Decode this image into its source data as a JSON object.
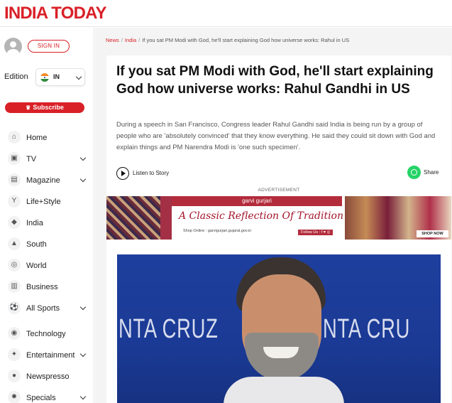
{
  "header": {
    "logo_text": "INDIA TODAY"
  },
  "sidebar": {
    "signin_label": "SIGN IN",
    "edition_label": "Edition",
    "edition_code": "IN",
    "subscribe_label": "Subscribe",
    "items": [
      {
        "label": "Home",
        "icon": "home-icon",
        "has_chevron": false
      },
      {
        "label": "TV",
        "icon": "live-tv-icon",
        "has_chevron": true
      },
      {
        "label": "Magazine",
        "icon": "magazine-icon",
        "has_chevron": true
      },
      {
        "label": "Life+Style",
        "icon": "cocktail-icon",
        "has_chevron": false
      },
      {
        "label": "India",
        "icon": "india-icon",
        "has_chevron": false
      },
      {
        "label": "South",
        "icon": "temple-icon",
        "has_chevron": false
      },
      {
        "label": "World",
        "icon": "globe-icon",
        "has_chevron": false
      },
      {
        "label": "Business",
        "icon": "chart-icon",
        "has_chevron": false
      },
      {
        "label": "All Sports",
        "icon": "sports-icon",
        "has_chevron": true
      },
      {
        "label": "Technology",
        "icon": "technology-icon",
        "has_chevron": false
      },
      {
        "label": "Entertainment",
        "icon": "entertainment-icon",
        "has_chevron": true
      },
      {
        "label": "Newspresso",
        "icon": "coffee-icon",
        "has_chevron": false
      },
      {
        "label": "Specials",
        "icon": "specials-icon",
        "has_chevron": true
      }
    ]
  },
  "breadcrumb": {
    "items": [
      "News",
      "India"
    ],
    "current": "If you sat PM Modi with God, he'll start explaining God how universe works: Rahul in US"
  },
  "article": {
    "headline": "If you sat PM Modi with God, he'll start explaining God how universe works: Rahul Gandhi in US",
    "summary": "During a speech in San Francisco, Congress leader Rahul Gandhi said India is being run by a group of people who are 'absolutely convinced' that they know everything. He said they could sit down with God and explain things and PM Narendra Modi is 'one such specimen'.",
    "listen_label": "Listen to Story",
    "share_label": "Share"
  },
  "ad": {
    "label": "ADVERTISEMENT",
    "brand": "garvi gurjari",
    "tagline": "A Classic Reflection Of Tradition",
    "shop_text": "Shop Online : garvigurjari.gujarat.gov.in",
    "follow_text": "Follow Us : f ♥ ◎",
    "cta": "SHOP NOW"
  },
  "photo": {
    "backdrop_left": "NTA CRUZ",
    "backdrop_right": "NTA CRU"
  },
  "colors": {
    "brand_red": "#d92027",
    "whatsapp_green": "#25d366"
  }
}
